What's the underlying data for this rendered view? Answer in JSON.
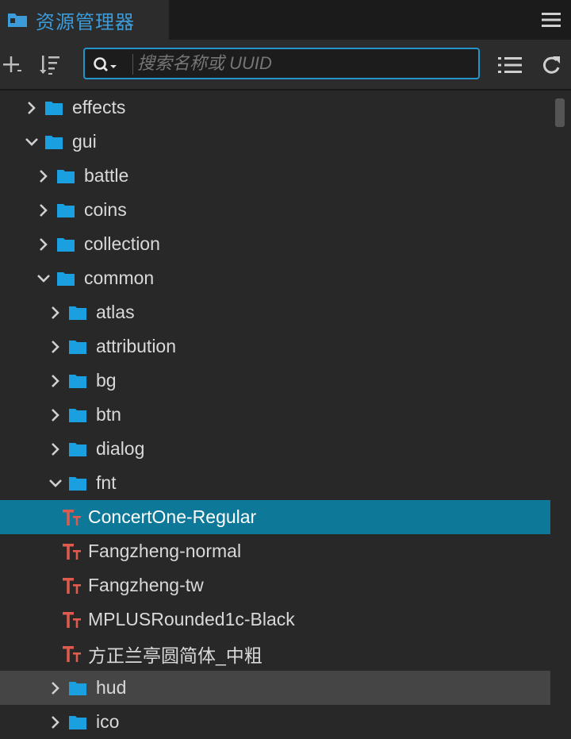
{
  "panel": {
    "title": "资源管理器",
    "accent": "#3b9cd9"
  },
  "toolbar": {
    "icons": [
      "add-icon",
      "sort-icon",
      "list-icon",
      "refresh-icon"
    ],
    "search": {
      "placeholder": "搜索名称或 UUID",
      "value": ""
    }
  },
  "tree": {
    "items": [
      {
        "label": "effects",
        "type": "folder",
        "level": 0,
        "expanded": false
      },
      {
        "label": "gui",
        "type": "folder",
        "level": 0,
        "expanded": true
      },
      {
        "label": "battle",
        "type": "folder",
        "level": 1,
        "expanded": false
      },
      {
        "label": "coins",
        "type": "folder",
        "level": 1,
        "expanded": false
      },
      {
        "label": "collection",
        "type": "folder",
        "level": 1,
        "expanded": false
      },
      {
        "label": "common",
        "type": "folder",
        "level": 1,
        "expanded": true
      },
      {
        "label": "atlas",
        "type": "folder",
        "level": 2,
        "expanded": false
      },
      {
        "label": "attribution",
        "type": "folder",
        "level": 2,
        "expanded": false
      },
      {
        "label": "bg",
        "type": "folder",
        "level": 2,
        "expanded": false
      },
      {
        "label": "btn",
        "type": "folder",
        "level": 2,
        "expanded": false
      },
      {
        "label": "dialog",
        "type": "folder",
        "level": 2,
        "expanded": false
      },
      {
        "label": "fnt",
        "type": "folder",
        "level": 2,
        "expanded": true
      },
      {
        "label": "ConcertOne-Regular",
        "type": "font",
        "level": 3,
        "selected": true
      },
      {
        "label": "Fangzheng-normal",
        "type": "font",
        "level": 3
      },
      {
        "label": "Fangzheng-tw",
        "type": "font",
        "level": 3
      },
      {
        "label": "MPLUSRounded1c-Black",
        "type": "font",
        "level": 3
      },
      {
        "label": "方正兰亭圆简体_中粗",
        "type": "font",
        "level": 3
      },
      {
        "label": "hud",
        "type": "folder",
        "level": 2,
        "expanded": false,
        "hover": true
      },
      {
        "label": "ico",
        "type": "folder",
        "level": 2,
        "expanded": false
      }
    ]
  },
  "colors": {
    "folder": "#1a9fe0",
    "font_icon": "#e05a4e",
    "selected_row": "#0e7899",
    "hover_row": "#454545"
  }
}
